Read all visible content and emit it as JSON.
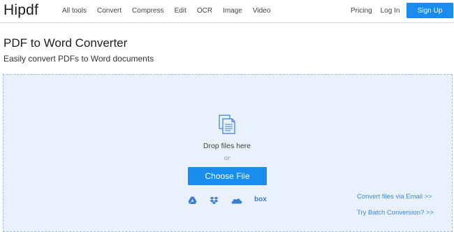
{
  "header": {
    "logo": "Hipdf",
    "nav": [
      "All tools",
      "Convert",
      "Compress",
      "Edit",
      "OCR",
      "Image",
      "Video"
    ],
    "pricing": "Pricing",
    "login": "Log In",
    "signup": "Sign Up",
    "accent": "#1a8cf0"
  },
  "main": {
    "title": "PDF to Word Converter",
    "subtitle": "Easily convert PDFs to Word documents"
  },
  "upload": {
    "drop_text": "Drop files here",
    "or_text": "or",
    "choose_label": "Choose File",
    "clouds": [
      "google-drive-icon",
      "dropbox-icon",
      "onedrive-icon",
      "box-icon"
    ],
    "box_label": "box",
    "email_link": "Convert files via Email >>",
    "batch_link": "Try Batch Conversion? >>",
    "bg_color": "#e8f1fc"
  }
}
